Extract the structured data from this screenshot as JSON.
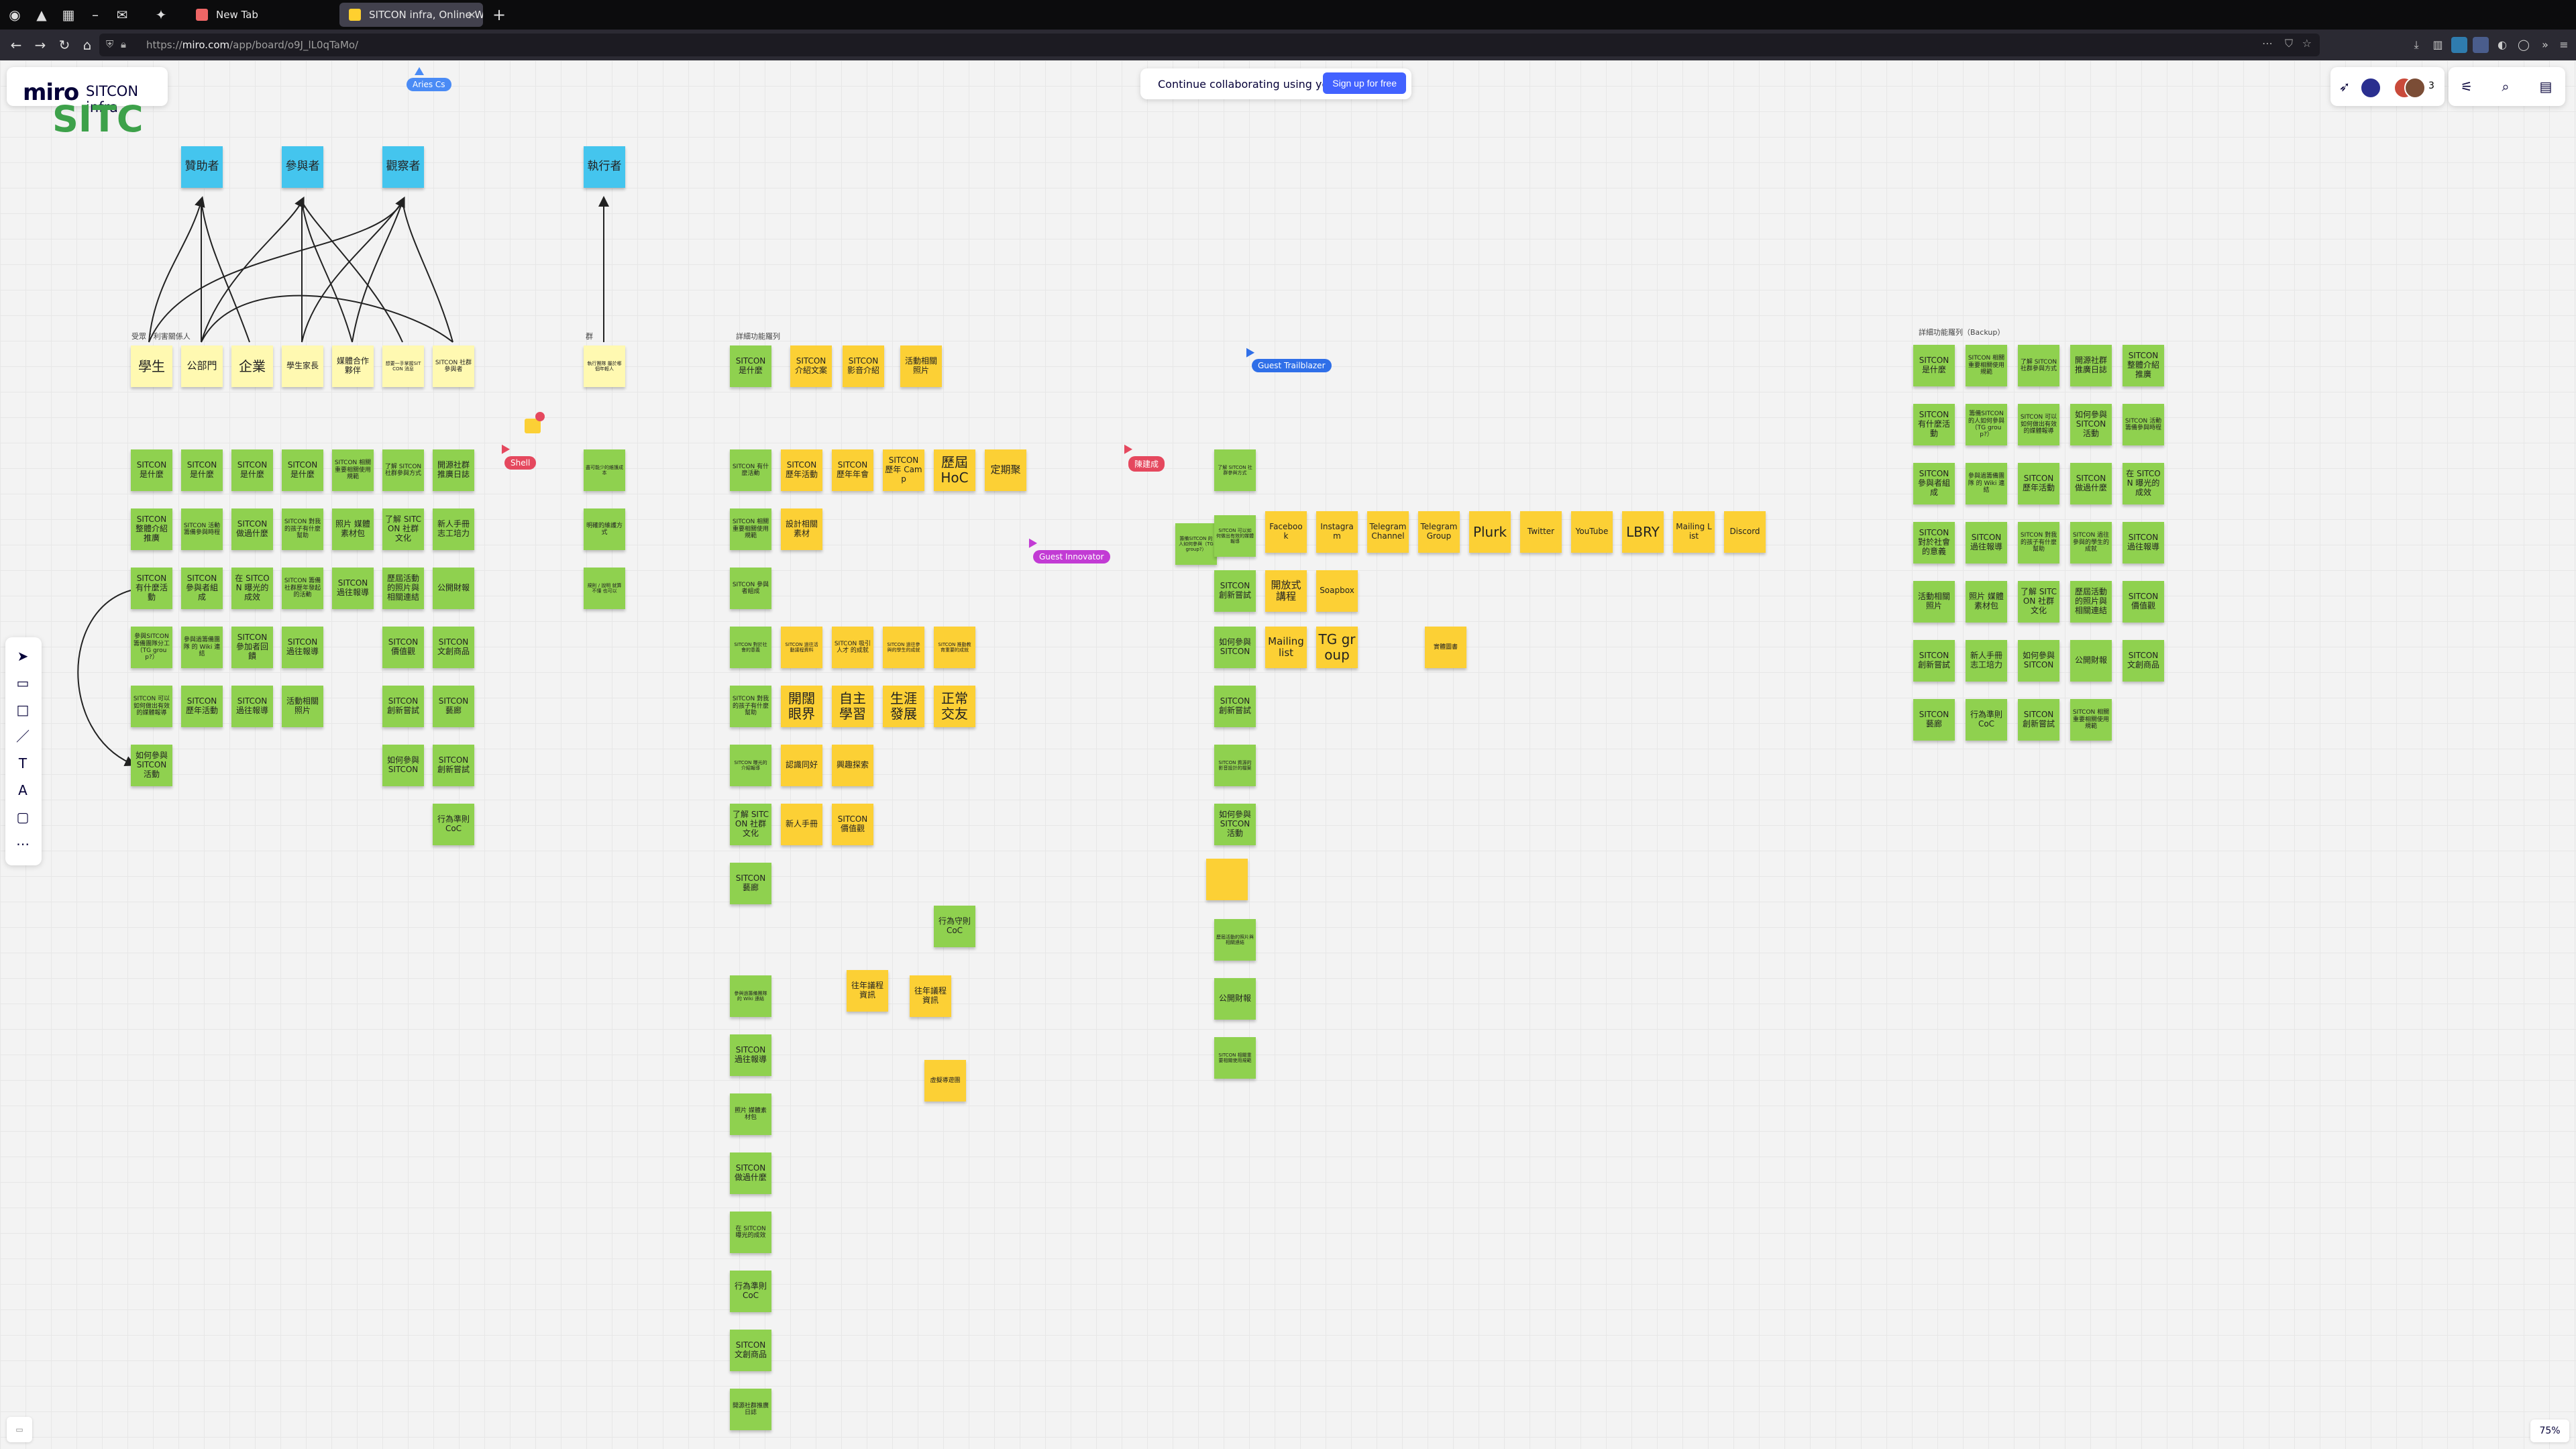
{
  "browser": {
    "tabs": [
      {
        "label": "New Tab"
      },
      {
        "label": "SITCON infra, Online Whiteboard for Visual Collaboration"
      }
    ],
    "url_prefix": "https://",
    "url_domain": "miro.com",
    "url_path": "/app/board/o9J_lL0qTaMo/"
  },
  "board": {
    "logo": "miro",
    "name": "SITCON infra",
    "banner_text": "Continue collaborating using your real name.",
    "signup_label": "Sign up for free",
    "collaborator_count": "3",
    "zoom": "75%"
  },
  "colors": {
    "green": "#8fd14f",
    "yellow": "#fcd035",
    "blue": "#44c5ee",
    "light_yellow": "#fff9b1",
    "canvas": "#f3f3f3"
  },
  "frames": {
    "left": "受眾 / 利害關係人",
    "mid": "詳細功能羅列",
    "small": "群",
    "backup": "詳細功能羅列（Backup）"
  },
  "cursors": [
    {
      "name": "Aries Cs",
      "color": "#4a8bf5"
    },
    {
      "name": "Guest Trailblazer",
      "color": "#2f6fe8"
    },
    {
      "name": "Guest Innovator",
      "color": "#c23bd4"
    },
    {
      "name": "Shell",
      "color": "#e5485e"
    },
    {
      "name": "陳建成",
      "color": "#e5485e"
    }
  ],
  "blue_notes": [
    "贊助者",
    "參與者",
    "觀察者",
    "執行者"
  ],
  "stakeholder_notes": [
    "學生",
    "公部門",
    "企業",
    "學生家長",
    "媒體合作夥伴",
    "想要一手掌握SITCON 消息",
    "SITCON 社群參與者",
    "執行團隊 屬於哪個年輕人"
  ],
  "notes": {
    "L1": [
      "SITCON 是什麼",
      "SITCON 是什麼",
      "SITCON 是什麼",
      "SITCON 是什麼",
      "SITCON 相關重要相關使用規範",
      "了解 SITCON 社群參與方式",
      "開源社群推廣日誌"
    ],
    "L2": [
      "SITCON 整體介紹推廣",
      "SITCON 活動籌備參與時程",
      "SITCON 做過什麼",
      "SITCON 對我的孩子有什麼幫助",
      "照片 媒體素材包",
      "了解 SITCON 社群文化",
      "新人手冊 志工培力"
    ],
    "L3": [
      "SITCON 有什麼活動",
      "SITCON 參與者組成",
      "在 SITCON 曝光的成效",
      "SITCON 籌備社群歷年發起的活動",
      "SITCON 過往報導",
      "歷屆活動的照片與相關連結",
      "公開財報"
    ],
    "L4": [
      "參與SITCON 籌備團隊分工（TG group?）",
      "參與過籌備團隊 的 Wiki 連結",
      "SITCON 參加者回饋",
      "SITCON 過往報導",
      "SITCON 價值觀",
      "SITCON 文創商品"
    ],
    "L5": [
      "SITCON 可以如何做出有效的媒體報導",
      "SITCON 歷年活動",
      "SITCON 過往報導",
      "活動相關照片",
      "SITCON 創新嘗試",
      "SITCON 藝廊"
    ],
    "L6": [
      "如何參與 SITCON 活動",
      "如何參與 SITCON",
      "SITCON 創新嘗試",
      "行為準則 CoC"
    ],
    "small_col": [
      "執行團隊屬於哪個年輕人",
      "盡可能少的維護成本",
      "明確的維護方式",
      "規則 / 說明 就算不懂 也可以"
    ],
    "M_top": [
      "SITCON 是什麼",
      "SITCON 介紹文案",
      "SITCON 影音介紹",
      "活動相關照片"
    ],
    "M_row": [
      "SITCON 有什麼活動",
      "SITCON 歷年活動",
      "SITCON 歷年年會",
      "SITCON 歷年 Camp",
      "歷屆 HoC",
      "定期聚"
    ],
    "M_col": [
      "SITCON 相關重要相關使用規範",
      "設計相關素材",
      "SITCON 參與者組成",
      "SITCON 對於社會的意義",
      "SITCON 過往活動議程資料",
      "SITCON 吸引人才 的成就",
      "SITCON 過往參與的學生的成就",
      "SITCON 推動教育重要的成就",
      "SITCON 對我的孩子有什麼幫助",
      "開闊 眼界",
      "自主 學習",
      "生涯 發展",
      "正常 交友",
      "SITCON 曝光的介紹報導",
      "認識同好",
      "興趣探索",
      "了解 SITCON 社群文化",
      "新人手冊",
      "SITCON 價值觀",
      "SITCON 藝廊",
      "行為守則 CoC",
      "往年議程 資訊",
      "往年議程 資訊",
      "參與過籌備團隊 的 Wiki 連結",
      "SITCON 過往報導",
      "照片 媒體素材包",
      "SITCON 做過什麼",
      "在 SITCON 曝光的成效",
      "行為準則 CoC",
      "SITCON 文創商品",
      "開源社群推廣日誌",
      "虛擬導遊團"
    ],
    "R_col": [
      "了解 SITCON 社群參與方式",
      "籌備SITCON 的人如何參與（TG group?）",
      "SITCON 可以如何做出有效的媒體報導",
      "SITCON 創新嘗試",
      "開放式講程",
      "Soapbox",
      "如何參與 SITCON",
      "Mailing list",
      "TG group",
      "實體圖書",
      "SITCON 創新嘗試",
      "SITCON 資源的影音設計的檔案",
      "如何參與 SITCON 活動",
      "歷屆活動的照片與相關連結",
      "公開財報",
      "SITCON 相關重要相關使用規範"
    ],
    "channels": [
      "Facebook",
      "Instagram",
      "Telegram Channel",
      "Telegram Group",
      "Plurk",
      "Twitter",
      "YouTube",
      "LBRY",
      "Mailing List",
      "Discord"
    ],
    "backup": [
      "SITCON 是什麼",
      "SITCON 相關重要相關使用規範",
      "了解 SITCON 社群參與方式",
      "開源社群推廣日誌",
      "SITCON 整體介紹推廣",
      "SITCON 有什麼活動",
      "籌備SITCON 的人如何參與（TG group?）",
      "SITCON 可以如何做出有效的媒體報導",
      "如何參與 SITCON 活動",
      "SITCON 活動籌備參與時程",
      "SITCON 參與者組成",
      "參與過籌備團隊 的 Wiki 連結",
      "SITCON 歷年活動",
      "SITCON 做過什麼",
      "在 SITCON 曝光的成效",
      "SITCON 對於社會的意義",
      "SITCON 過往報導",
      "SITCON 對我的孩子有什麼幫助",
      "SITCON 過往參與的學生的成就",
      "SITCON 過往報導",
      "活動相關照片",
      "照片 媒體素材包",
      "了解 SITCON 社群文化",
      "歷屆活動的照片與相關連結",
      "SITCON 價值觀",
      "SITCON 創新嘗試",
      "新人手冊 志工培力",
      "如何參與 SITCON",
      "公開財報",
      "SITCON 文創商品",
      "SITCON 藝廊",
      "行為準則 CoC",
      "SITCON 創新嘗試",
      "SITCON 相關重要相關使用規範"
    ]
  }
}
